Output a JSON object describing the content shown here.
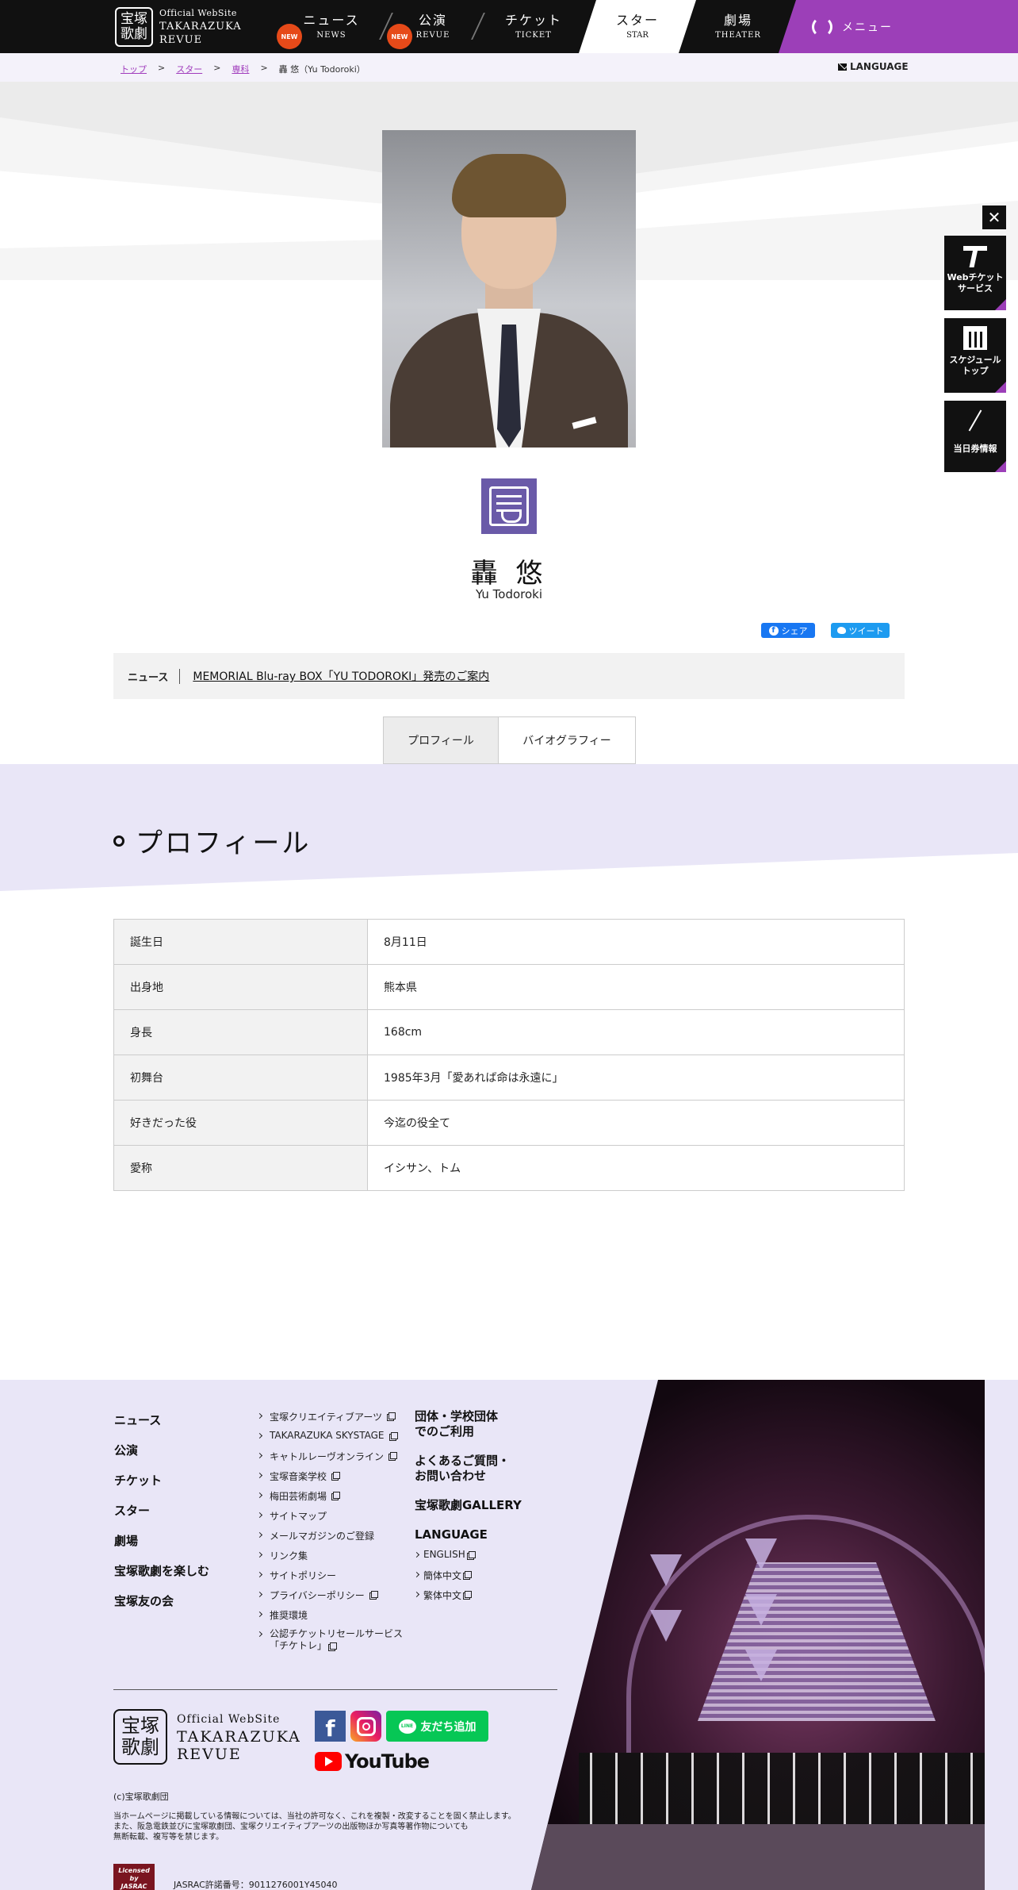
{
  "header": {
    "logo_mark_line1": "宝塚",
    "logo_mark_line2": "歌劇",
    "logo_small": "Official WebSite",
    "logo_line1": "TAKARAZUKA",
    "logo_line2": "REVUE",
    "nav": [
      {
        "jp": "ニュース",
        "en": "NEWS",
        "badge": "NEW"
      },
      {
        "jp": "公演",
        "en": "REVUE",
        "badge": "NEW"
      },
      {
        "jp": "チケット",
        "en": "TICKET"
      },
      {
        "jp": "スター",
        "en": "STAR"
      },
      {
        "jp": "劇場",
        "en": "THEATER"
      }
    ],
    "menu_label": "メニュー"
  },
  "breadcrumb": {
    "items": [
      "トップ",
      "スター",
      "専科",
      "轟 悠（Yu Todoroki）"
    ],
    "separator": ">"
  },
  "language_label": "LANGUAGE",
  "star": {
    "name_jp": "轟 悠",
    "name_en": "Yu Todoroki"
  },
  "share": {
    "facebook_label": "シェア",
    "twitter_label": "ツイート"
  },
  "news": {
    "label": "ニュース",
    "link_text": "MEMORIAL Blu-ray BOX「YU TODOROKI」発売のご案内"
  },
  "tabs": [
    {
      "label": "プロフィール",
      "active": true
    },
    {
      "label": "バイオグラフィー",
      "active": false
    }
  ],
  "profile": {
    "title": "プロフィール",
    "rows": [
      {
        "key": "誕生日",
        "value": "8月11日"
      },
      {
        "key": "出身地",
        "value": "熊本県"
      },
      {
        "key": "身長",
        "value": "168cm"
      },
      {
        "key": "初舞台",
        "value": "1985年3月「愛あれば命は永遠に」"
      },
      {
        "key": "好きだった役",
        "value": "今迄の役全て"
      },
      {
        "key": "愛称",
        "value": "イシサン、トム"
      }
    ]
  },
  "side_widget": {
    "close_label": "✕",
    "buttons": [
      {
        "line1": "Webチケット",
        "line2": "サービス"
      },
      {
        "line1": "スケジュール",
        "line2": "トップ"
      },
      {
        "line1": "当日券情報",
        "line2": ""
      }
    ]
  },
  "footer": {
    "col1": [
      "ニュース",
      "公演",
      "チケット",
      "スター",
      "劇場",
      "宝塚歌劇を楽しむ",
      "宝塚友の会"
    ],
    "col2": [
      {
        "label": "宝塚クリエイティブアーツ",
        "external": true
      },
      {
        "label": "TAKARAZUKA SKYSTAGE",
        "external": true
      },
      {
        "label": "キャトルレーヴオンライン",
        "external": true
      },
      {
        "label": "宝塚音楽学校",
        "external": true
      },
      {
        "label": "梅田芸術劇場",
        "external": true
      },
      {
        "label": "サイトマップ",
        "external": false
      },
      {
        "label": "メールマガジンのご登録",
        "external": false
      },
      {
        "label": "リンク集",
        "external": false
      },
      {
        "label": "サイトポリシー",
        "external": false
      },
      {
        "label": "プライバシーポリシー",
        "external": true
      },
      {
        "label": "推奨環境",
        "external": false
      },
      {
        "label": "公認チケットリセールサービス",
        "label2": "「チケトレ」",
        "external": true
      }
    ],
    "col3_big": [
      {
        "line1": "団体・学校団体",
        "line2": "でのご利用"
      },
      {
        "line1": "よくあるご質問・",
        "line2": "お問い合わせ"
      },
      {
        "line1": "宝塚歌劇GALLERY",
        "line2": ""
      },
      {
        "line1": "LANGUAGE",
        "line2": ""
      }
    ],
    "languages": [
      "ENGLISH",
      "簡体中文",
      "繁体中文"
    ],
    "logo_small": "Official WebSite",
    "logo_line1": "TAKARAZUKA",
    "logo_line2": "REVUE",
    "sns_facebook": "f",
    "line_label": "友だち追加",
    "line_icon": "LINE",
    "youtube_label": "YouTube",
    "copyright": "(c)宝塚歌劇団",
    "notice_line1": "当ホームページに掲載している情報については、当社の許可なく、これを複製・改変することを固く禁止します。",
    "notice_line2": "また、阪急電鉄並びに宝塚歌劇団、宝塚クリエイティブアーツの出版物ほか写真等著作物についても",
    "notice_line3": "無断転載、複写等を禁じます。",
    "jasrac_badge_line1": "Licensed",
    "jasrac_badge_line2": "by",
    "jasrac_badge_line3": "JASRAC",
    "jasrac": "JASRAC許諾番号：9011276001Y45040"
  }
}
